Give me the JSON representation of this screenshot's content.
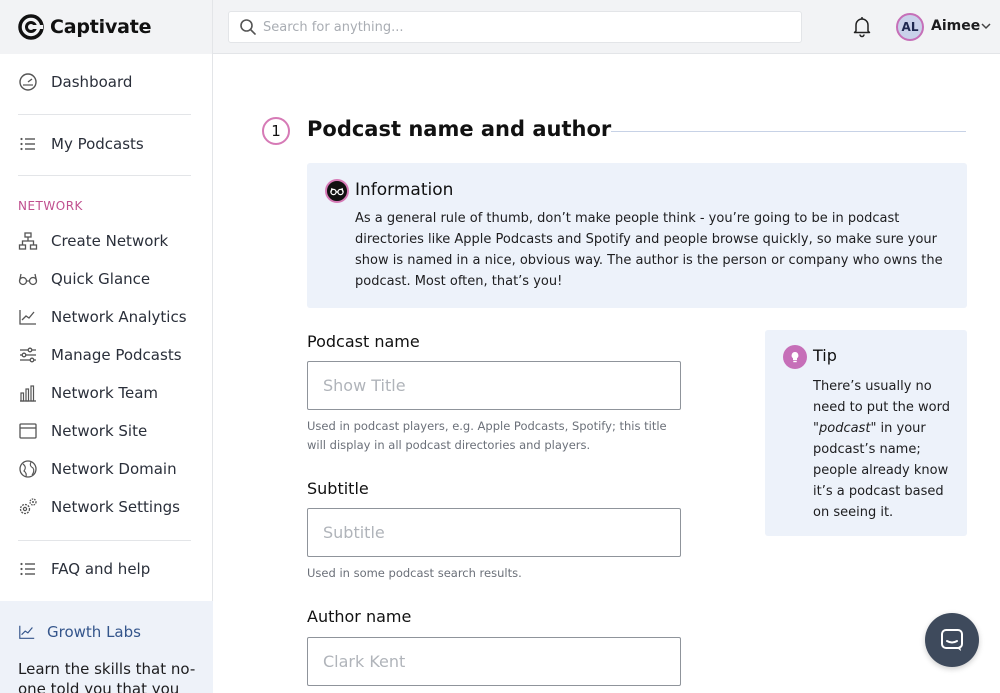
{
  "app": {
    "name": "Captivate"
  },
  "search": {
    "placeholder": "Search for anything..."
  },
  "user": {
    "initials": "AL",
    "name": "Aimee"
  },
  "sidebar": {
    "dashboard": "Dashboard",
    "my_podcasts": "My Podcasts",
    "section_network": "NETWORK",
    "network_items": [
      {
        "label": "Create Network",
        "icon": "sitemap-icon"
      },
      {
        "label": "Quick Glance",
        "icon": "glasses-icon"
      },
      {
        "label": "Network Analytics",
        "icon": "chart-line-icon"
      },
      {
        "label": "Manage Podcasts",
        "icon": "sliders-icon"
      },
      {
        "label": "Network Team",
        "icon": "bar-chart-icon"
      },
      {
        "label": "Network Site",
        "icon": "browser-window-icon"
      },
      {
        "label": "Network Domain",
        "icon": "globe-icon"
      },
      {
        "label": "Network Settings",
        "icon": "gears-icon"
      }
    ],
    "faq": "FAQ and help",
    "growth_labs": {
      "title": "Growth Labs",
      "text": "Learn the skills that no-one told you that you"
    }
  },
  "step": {
    "number": "1",
    "title": "Podcast name and author"
  },
  "information": {
    "title": "Information",
    "text": "As a general rule of thumb, don’t make people think - you’re going to be in podcast directories like Apple Podcasts and Spotify and people browse quickly, so make sure your show is named in a nice, obvious way. The author is the person or company who owns the podcast. Most often, that’s you!"
  },
  "fields": {
    "podcast_name": {
      "label": "Podcast name",
      "placeholder": "Show Title",
      "help": "Used in podcast players, e.g. Apple Podcasts, Spotify; this title will display in all podcast directories and players."
    },
    "subtitle": {
      "label": "Subtitle",
      "placeholder": "Subtitle",
      "help": "Used in some podcast search results."
    },
    "author": {
      "label": "Author name",
      "placeholder": "Clark Kent"
    }
  },
  "tip": {
    "title": "Tip",
    "text_before": "There’s usually no need to put the word \"",
    "text_em": "podcast",
    "text_after": "\" in your podcast’s name; people already know it’s a podcast based on seeing it."
  },
  "colors": {
    "accent_pink": "#c66fb8",
    "panel_bg": "#edf2fa",
    "network_label": "#c0508f"
  }
}
